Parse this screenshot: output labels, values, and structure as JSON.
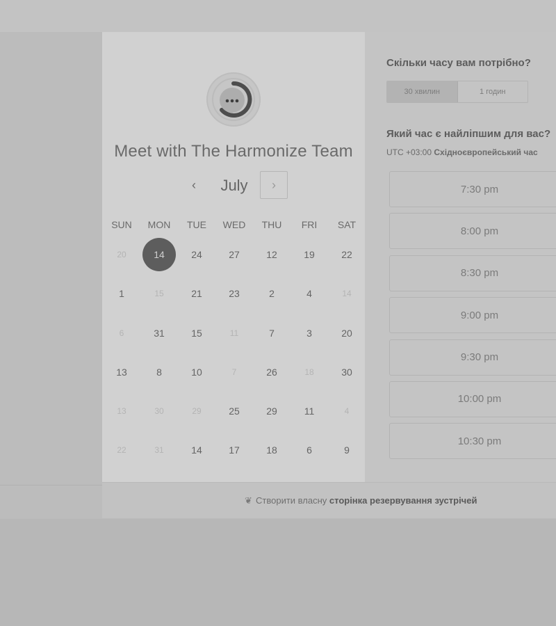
{
  "host": {
    "title": "Meet with The Harmonize Team",
    "logo_icon": "chat-bubble-icon"
  },
  "calendar": {
    "month": "July",
    "prev_icon": "‹",
    "next_icon": "›",
    "weekdays": [
      "SUN",
      "MON",
      "TUE",
      "WED",
      "THU",
      "FRI",
      "SAT"
    ],
    "weeks": [
      [
        {
          "d": "20",
          "muted": true
        },
        {
          "d": "14",
          "selected": true
        },
        {
          "d": "24"
        },
        {
          "d": "27"
        },
        {
          "d": "12"
        },
        {
          "d": "19"
        },
        {
          "d": "22"
        }
      ],
      [
        {
          "d": "1"
        },
        {
          "d": "15",
          "muted": true
        },
        {
          "d": "21"
        },
        {
          "d": "23"
        },
        {
          "d": "2"
        },
        {
          "d": "4"
        },
        {
          "d": "14",
          "muted": true
        }
      ],
      [
        {
          "d": "6",
          "muted": true
        },
        {
          "d": "31"
        },
        {
          "d": "15"
        },
        {
          "d": "11",
          "muted": true
        },
        {
          "d": "7"
        },
        {
          "d": "3"
        },
        {
          "d": "20"
        }
      ],
      [
        {
          "d": "13"
        },
        {
          "d": "8"
        },
        {
          "d": "10"
        },
        {
          "d": "7",
          "muted": true
        },
        {
          "d": "26"
        },
        {
          "d": "18",
          "muted": true
        },
        {
          "d": "30"
        }
      ],
      [
        {
          "d": "13",
          "muted": true
        },
        {
          "d": "30",
          "muted": true
        },
        {
          "d": "29",
          "muted": true
        },
        {
          "d": "25"
        },
        {
          "d": "29"
        },
        {
          "d": "11"
        },
        {
          "d": "4",
          "muted": true
        }
      ],
      [
        {
          "d": "22",
          "muted": true
        },
        {
          "d": "31",
          "muted": true
        },
        {
          "d": "14"
        },
        {
          "d": "17"
        },
        {
          "d": "18"
        },
        {
          "d": "6"
        },
        {
          "d": "9"
        }
      ]
    ]
  },
  "booking": {
    "duration_heading": "Скільки часу вам потрібно?",
    "durations": [
      "30 хвилин",
      "1 годин"
    ],
    "time_heading": "Який час є найліпшим для вас?",
    "timezone_offset": "UTC +03:00",
    "timezone_name": "Східноєвропейський час",
    "slots": [
      "7:30 pm",
      "8:00 pm",
      "8:30 pm",
      "9:00 pm",
      "9:30 pm",
      "10:00 pm",
      "10:30 pm"
    ]
  },
  "footer": {
    "icon": "sprout-icon",
    "text_plain": "Створити власну",
    "text_bold": "сторінка резервування зустрічей"
  }
}
